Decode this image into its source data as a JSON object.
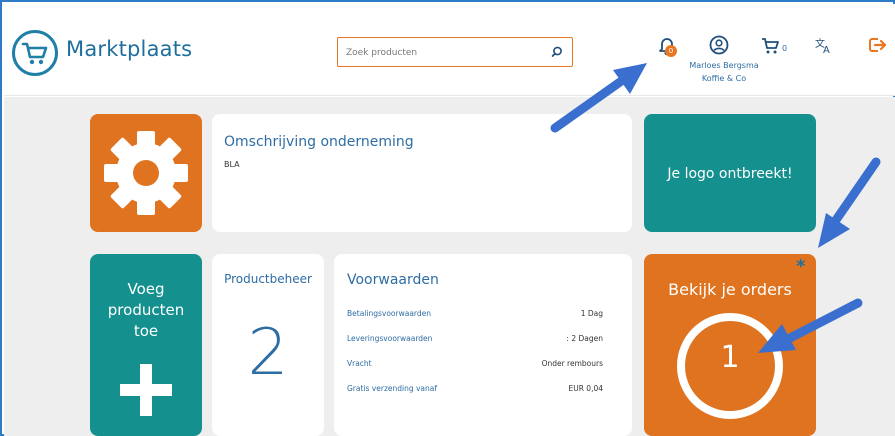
{
  "header": {
    "brand": "Marktplaats",
    "search_placeholder": "Zoek producten",
    "notification_count": "0",
    "user_name": "Marloes Bergsma",
    "user_company": "Koffie & Co",
    "cart_count": "0"
  },
  "tiles": {
    "description": {
      "title": "Omschrijving onderneming",
      "text": "BLA"
    },
    "logo": {
      "text": "Je logo ontbreekt!"
    },
    "add_products": {
      "line1": "Voeg",
      "line2": "producten",
      "line3": "toe"
    },
    "product_management": {
      "title": "Productbeheer",
      "count": "2"
    },
    "conditions": {
      "title": "Voorwaarden",
      "rows": [
        {
          "label": "Betalingsvoorwaarden",
          "value": "1 Dag"
        },
        {
          "label": "Leveringsvoorwaarden",
          "value": ": 2 Dagen"
        },
        {
          "label": "Vracht",
          "value": "Onder rembours"
        },
        {
          "label": "Gratis verzending vanaf",
          "value": "EUR 0,04"
        }
      ]
    },
    "orders": {
      "title": "Bekijk je orders",
      "asterisk": "*",
      "count": "1"
    }
  },
  "colors": {
    "orange": "#e07320",
    "teal": "#14908f",
    "blue_text": "#2e6da4",
    "arrow": "#3a6fcf"
  },
  "icons": [
    "cart-logo-icon",
    "search-icon",
    "bell-icon",
    "user-icon",
    "cart-icon",
    "translate-icon",
    "logout-icon",
    "gear-icon",
    "plus-icon"
  ]
}
